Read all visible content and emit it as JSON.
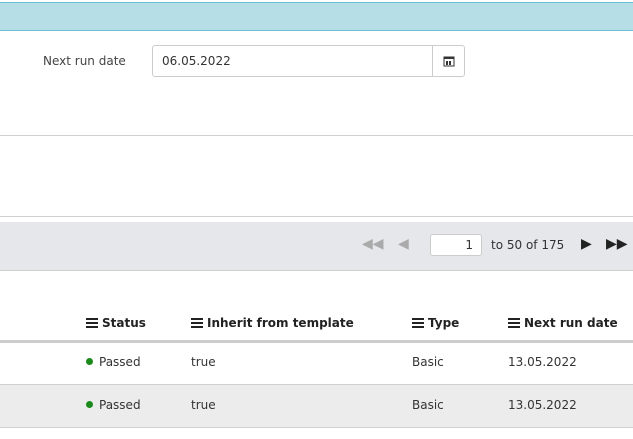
{
  "form": {
    "next_run_label": "Next run date",
    "next_run_value": "06.05.2022"
  },
  "pager": {
    "page": "1",
    "range_text": "to 50 of 175"
  },
  "table": {
    "headers": [
      "Status",
      "Inherit from template",
      "Type",
      "Next run date"
    ],
    "rows": [
      {
        "status": "Passed",
        "inherit": "true",
        "type": "Basic",
        "next_run": "13.05.2022"
      },
      {
        "status": "Passed",
        "inherit": "true",
        "type": "Basic",
        "next_run": "13.05.2022"
      }
    ]
  },
  "colors": {
    "banner": "#b5dee6",
    "status_passed": "#1a8a1a"
  }
}
